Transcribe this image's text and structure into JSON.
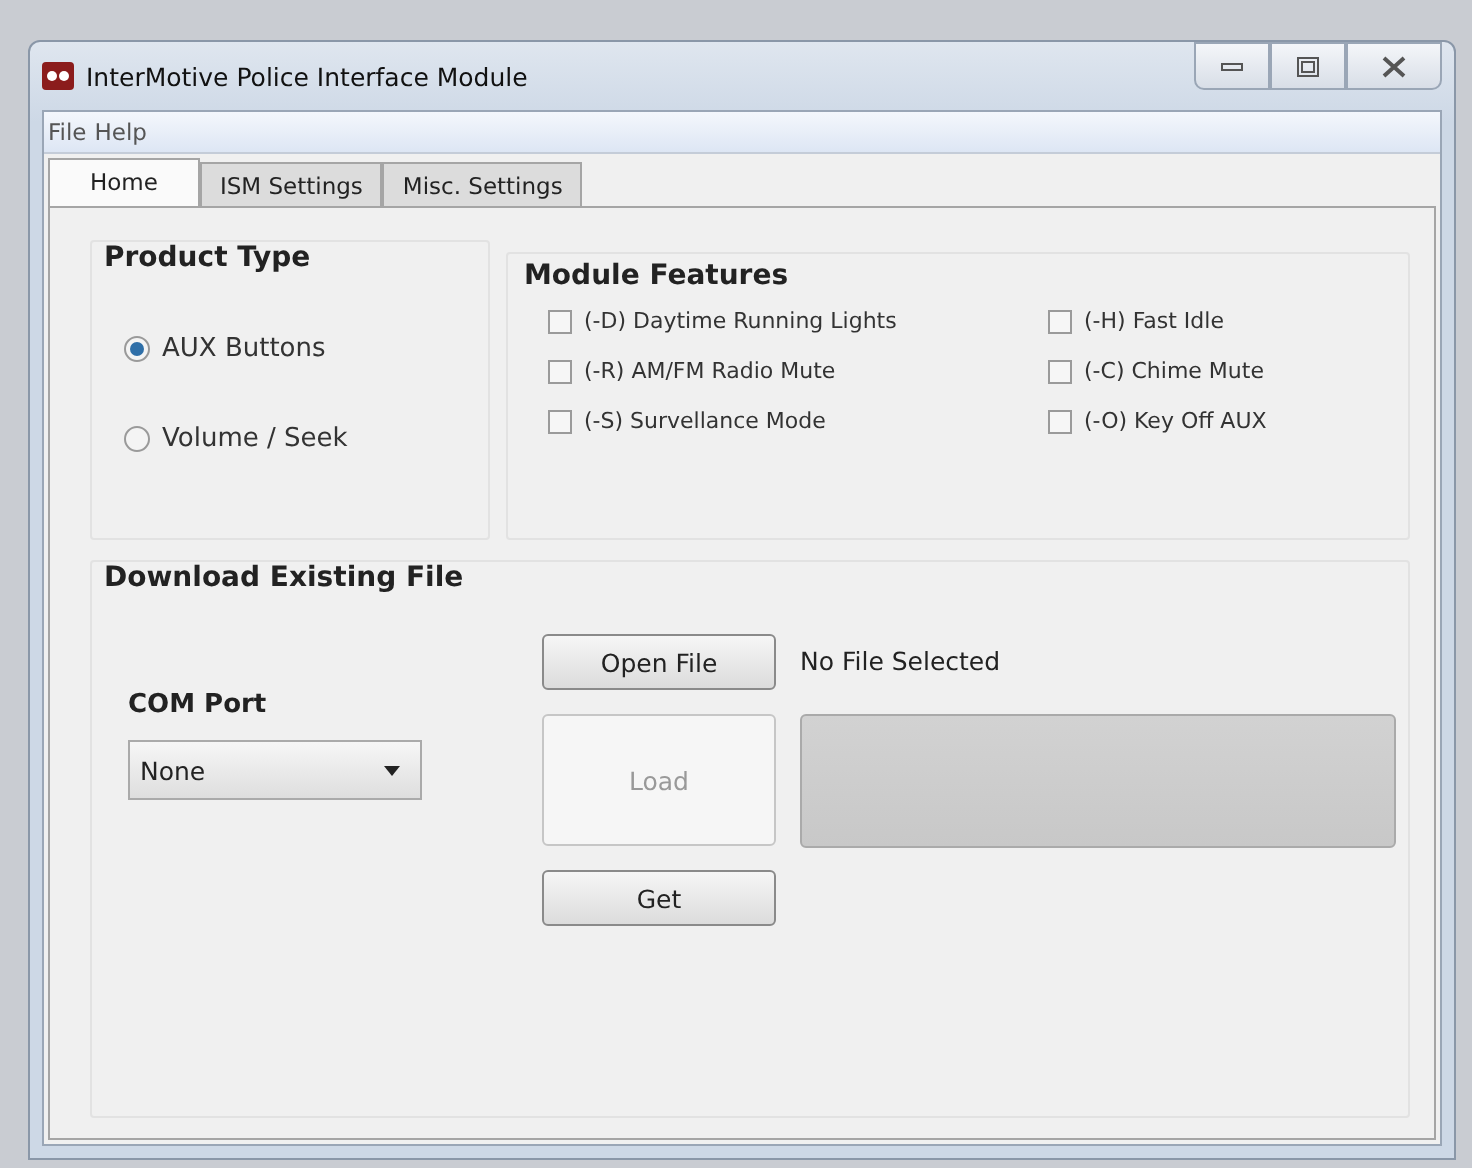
{
  "window": {
    "title": "InterMotive Police Interface Module"
  },
  "menu": [
    "File",
    "Help"
  ],
  "tabs": [
    {
      "label": "Home",
      "selected": true
    },
    {
      "label": "ISM Settings",
      "selected": false
    },
    {
      "label": "Misc. Settings",
      "selected": false
    }
  ],
  "product_type": {
    "title": "Product Type",
    "options": [
      {
        "label": "AUX Buttons",
        "selected": true
      },
      {
        "label": "Volume / Seek",
        "selected": false
      }
    ]
  },
  "module_features": {
    "title": "Module Features",
    "items": [
      {
        "label": "(-D) Daytime Running Lights",
        "checked": false
      },
      {
        "label": "(-H) Fast Idle",
        "checked": false
      },
      {
        "label": "(-R) AM/FM Radio Mute",
        "checked": false
      },
      {
        "label": "(-C) Chime Mute",
        "checked": false
      },
      {
        "label": "(-S) Survellance Mode",
        "checked": false
      },
      {
        "label": "(-O) Key Off AUX",
        "checked": false
      }
    ]
  },
  "download": {
    "title": "Download Existing File",
    "com_port_label": "COM Port",
    "com_port": "None",
    "buttons": [
      {
        "label": "Open File",
        "disabled": false
      },
      {
        "label": "Load",
        "disabled": true
      },
      {
        "label": "Get",
        "disabled": false
      }
    ],
    "file_status": "No File Selected"
  }
}
